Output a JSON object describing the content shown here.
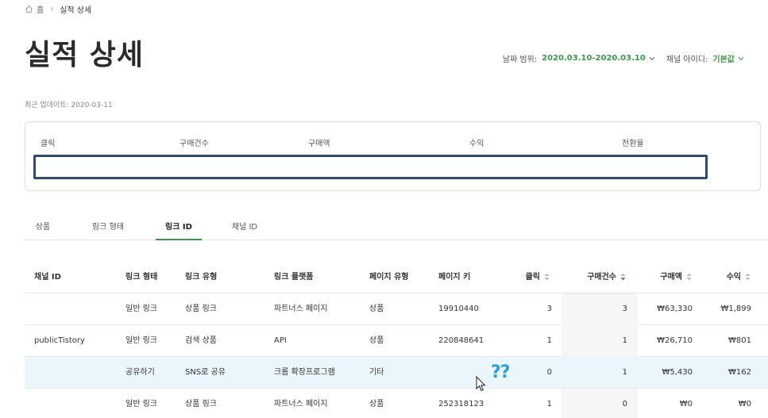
{
  "breadcrumb": {
    "home": "홈",
    "current": "실적 상세"
  },
  "page_title": "실적 상세",
  "filters": {
    "date_label": "날짜 범위:",
    "date_value": "2020.03.10-2020.03.10",
    "channel_label": "채널 아이디:",
    "channel_value": "기본값"
  },
  "updated": "최근 업데이트: 2020-03-11",
  "summary": {
    "labels": [
      "클릭",
      "구매건수",
      "구매액",
      "수익",
      "전환율"
    ],
    "value": ""
  },
  "tabs": [
    "상품",
    "링크 형태",
    "링크 ID",
    "채널 ID"
  ],
  "active_tab": "링크 ID",
  "table": {
    "headers": [
      "채널 ID",
      "링크 형태",
      "링크 유형",
      "링크 플랫폼",
      "페이지 유형",
      "페이지 키",
      "클릭",
      "구매건수",
      "구매액",
      "수익"
    ],
    "rows": [
      [
        "",
        "일반 링크",
        "상품 링크",
        "파트너스 페이지",
        "상품",
        "19910440",
        "3",
        "3",
        "₩63,330",
        "₩1,899"
      ],
      [
        "publicTistory",
        "일반 링크",
        "검색 상품",
        "API",
        "상품",
        "220848641",
        "1",
        "1",
        "₩26,710",
        "₩801"
      ],
      [
        "",
        "공유하기",
        "SNS로 공유",
        "크롬 확장프로그램",
        "기타",
        "",
        "0",
        "1",
        "₩5,430",
        "₩162"
      ],
      [
        "",
        "일반 링크",
        "상품 링크",
        "파트너스 페이지",
        "상품",
        "252318123",
        "1",
        "0",
        "₩0",
        "₩0"
      ]
    ],
    "highlighted_row": 2,
    "sort_active_column": "구매건수"
  },
  "overlay_text": "??",
  "colors": {
    "accent": "#3a9a4a",
    "highlight_row": "#eaf6fc",
    "focus_box": "#2f4a6a",
    "question_marks": "#2aa0d8"
  }
}
